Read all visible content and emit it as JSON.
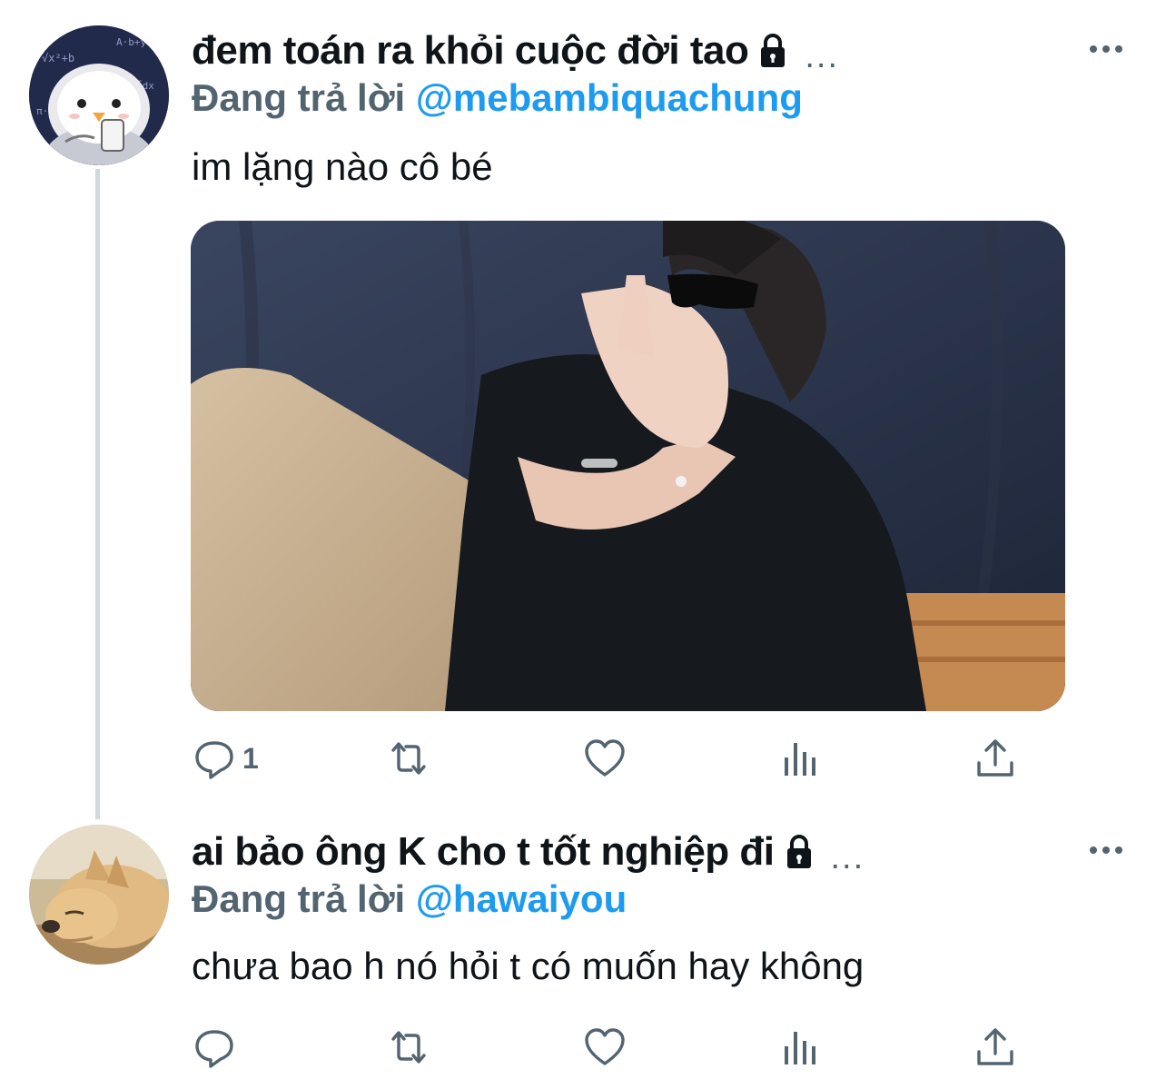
{
  "tweets": [
    {
      "display_name": "đem toán ra khỏi cuộc đời tao",
      "ellipsis": "...",
      "reply_prefix": "Đang trả lời",
      "reply_handle": "@mebambiquachung",
      "text": "im lặng nào cô bé",
      "avatar": "penguin-avatar",
      "has_media": true,
      "reply_count": "1"
    },
    {
      "display_name": "ai bảo ông K cho t tốt nghiệp đi",
      "ellipsis": "...",
      "reply_prefix": "Đang trả lời",
      "reply_handle": "@hawaiyou",
      "text": "chưa bao h nó hỏi t có muốn hay không",
      "avatar": "dog-avatar",
      "has_media": false,
      "reply_count": ""
    }
  ],
  "icons": [
    "lock-icon",
    "more-icon",
    "reply-icon",
    "retweet-icon",
    "like-icon",
    "views-icon",
    "share-icon"
  ],
  "colors": {
    "text_primary": "#0f1419",
    "text_secondary": "#536471",
    "link": "#1d9bf0",
    "thread_line": "#cfd9de"
  }
}
